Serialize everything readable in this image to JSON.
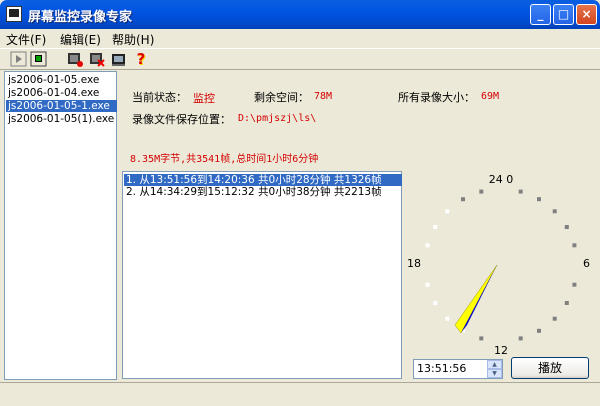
{
  "window": {
    "title": "屏幕监控录像专家",
    "minimize": "_",
    "maximize": "□",
    "close": "×"
  },
  "menu": {
    "items": [
      {
        "label": "文件(F)"
      },
      {
        "label": "编辑(E)"
      },
      {
        "label": "帮助(H)"
      }
    ]
  },
  "toolbar": {
    "buttons": [
      {
        "icon": "play-icon"
      },
      {
        "icon": "stop-icon"
      },
      {
        "icon": "record-icon"
      },
      {
        "icon": "record-delete-icon"
      },
      {
        "icon": "film-icon"
      },
      {
        "icon": "help-icon",
        "glyph": "?"
      }
    ]
  },
  "files": [
    {
      "name": "js2006-01-05.exe",
      "selected": false
    },
    {
      "name": "js2006-01-04.exe",
      "selected": false
    },
    {
      "name": "js2006-01-05-1.exe",
      "selected": true
    },
    {
      "name": "js2006-01-05(1).exe",
      "selected": false
    }
  ],
  "info": {
    "status_label": "当前状态：",
    "status_value": "监控",
    "free_label": "剩余空间：",
    "free_value": "78M",
    "total_label": "所有录像大小：",
    "total_value": "69M",
    "path_label": "录像文件保存位置：",
    "path_value": "D:\\pmjszj\\ls\\",
    "summary": "8.35M字节,共3541帧,总时间1小时6分钟"
  },
  "records": [
    {
      "text": "1. 从13:51:56到14:20:36 共0小时28分钟 共1326帧",
      "selected": true
    },
    {
      "text": "2. 从14:34:29到15:12:32 共0小时38分钟 共2213帧",
      "selected": false
    }
  ],
  "clock": {
    "label_top": "24 0",
    "label_right": "6",
    "label_bottom": "12",
    "label_left": "18",
    "hand1_color": "#ffff00",
    "hand2_color": "#0000cc"
  },
  "controls": {
    "time_value": "13:51:56",
    "spin_up": "▲",
    "spin_down": "▼",
    "play_label": "播放"
  }
}
